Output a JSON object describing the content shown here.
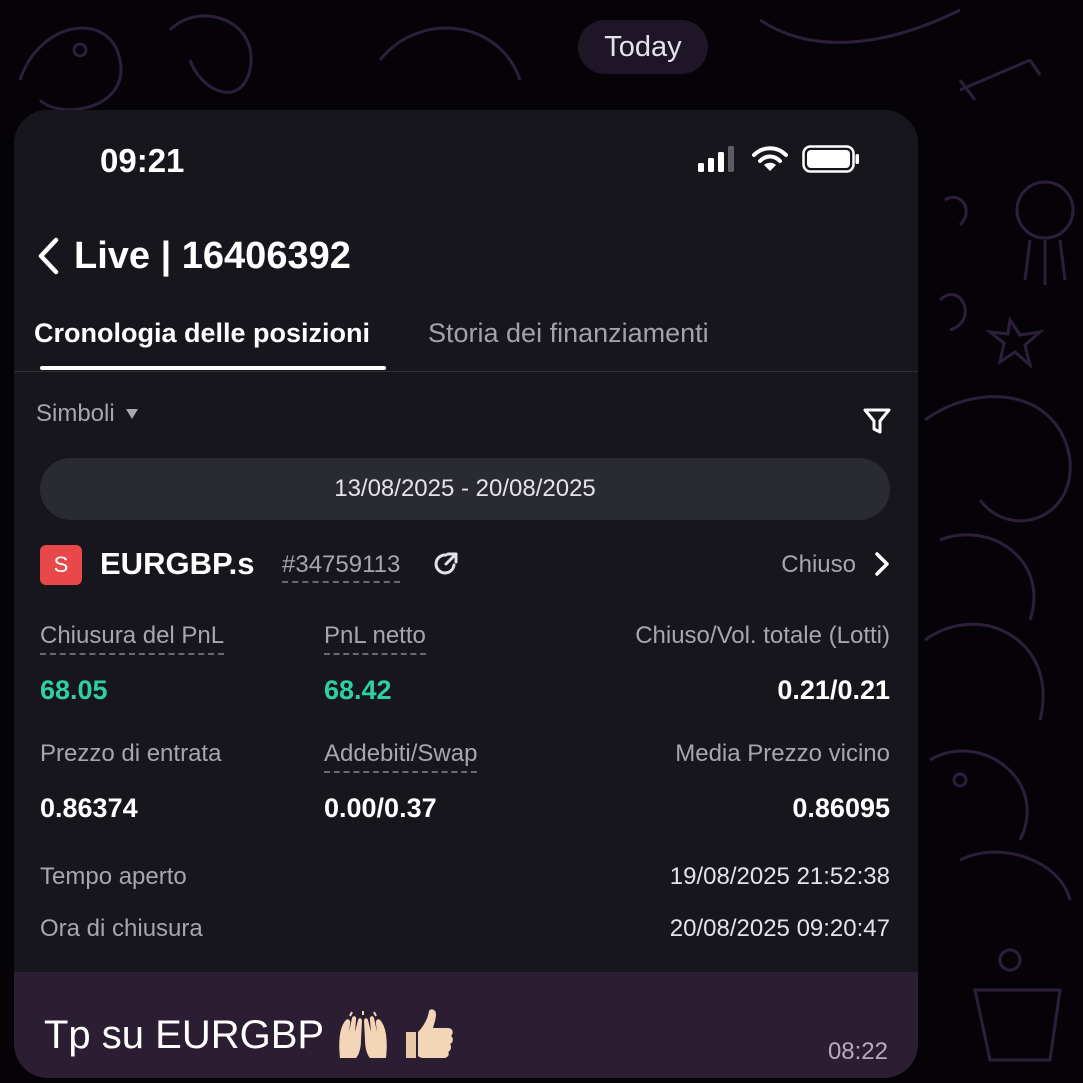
{
  "chat": {
    "date_separator": "Today",
    "message": {
      "text": "Tp su EURGBP",
      "emojis": [
        "raising-hands",
        "thumbs-up"
      ],
      "time": "08:22"
    }
  },
  "phone": {
    "status_bar": {
      "time": "09:21"
    },
    "header": {
      "title": "Live | 16406392"
    },
    "tabs": [
      {
        "label": "Cronologia delle posizioni",
        "active": true
      },
      {
        "label": "Storia dei finanziamenti",
        "active": false
      }
    ],
    "filters": {
      "symbols_label": "Simboli",
      "date_range": "13/08/2025 - 20/08/2025"
    },
    "position": {
      "badge": "S",
      "symbol": "EURGBP.s",
      "order_id": "#34759113",
      "status": "Chiuso",
      "fields": {
        "closing_pnl_label": "Chiusura del PnL",
        "closing_pnl": "68.05",
        "net_pnl_label": "PnL netto",
        "net_pnl": "68.42",
        "closed_volume_label": "Chiuso/Vol. totale (Lotti)",
        "closed_volume": "0.21/0.21",
        "entry_price_label": "Prezzo di entrata",
        "entry_price": "0.86374",
        "charges_swap_label": "Addebiti/Swap",
        "charges_swap": "0.00/0.37",
        "avg_close_price_label": "Media Prezzo vicino",
        "avg_close_price": "0.86095",
        "open_time_label": "Tempo aperto",
        "open_time": "19/08/2025 21:52:38",
        "close_time_label": "Ora di chiusura",
        "close_time": "20/08/2025 09:20:47"
      }
    }
  },
  "colors": {
    "chat_background": "#060308",
    "bubble": "#2b1e33",
    "app_background": "#16161c",
    "profit_green": "#2fd0a0",
    "sell_badge": "#e8484a"
  }
}
